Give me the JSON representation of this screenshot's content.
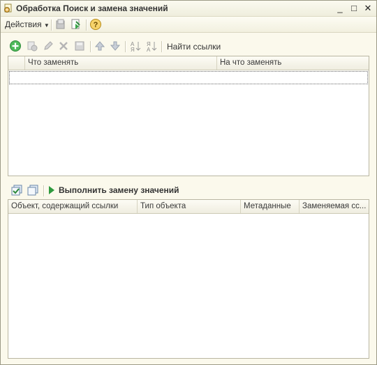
{
  "window": {
    "title": "Обработка  Поиск и замена значений",
    "controls": {
      "minimize": "_",
      "maximize": "□",
      "close": "✕"
    }
  },
  "toolbar": {
    "actions_label": "Действия",
    "help_glyph": "?"
  },
  "top_toolbar": {
    "find_links_label": "Найти ссылки"
  },
  "replace_table": {
    "columns": [
      "Что заменять",
      "На что заменять"
    ],
    "rows": []
  },
  "bottom_toolbar": {
    "run_replace_label": "Выполнить замену значений"
  },
  "results_table": {
    "columns": [
      "Объект, содержащий ссылки",
      "Тип объекта",
      "Метаданные",
      "Заменяемая сс..."
    ],
    "rows": []
  },
  "colors": {
    "background": "#fbf9ec",
    "accent_green": "#3aa64a",
    "border": "#b9b6a2"
  }
}
